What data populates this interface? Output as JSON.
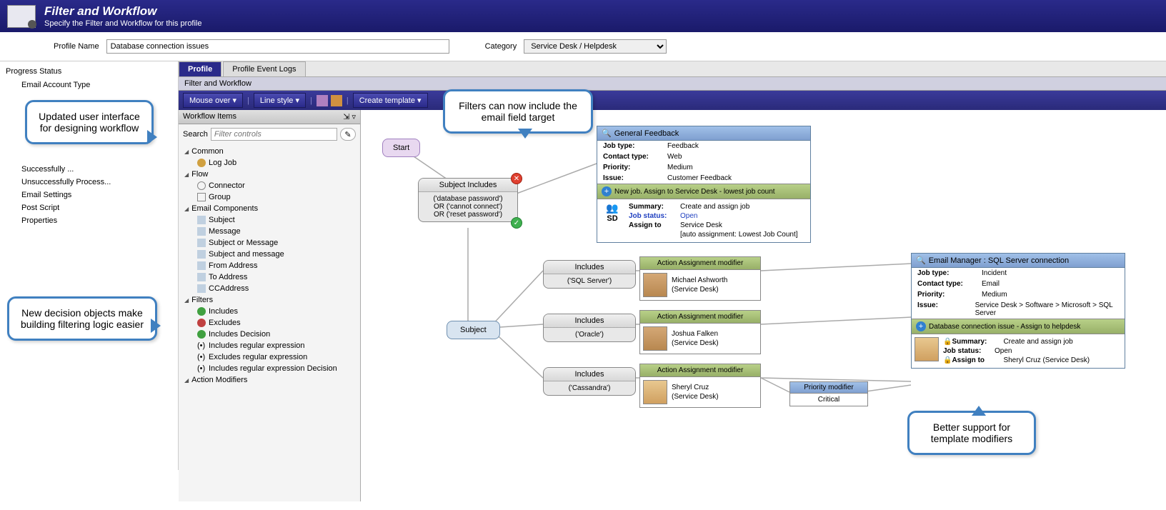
{
  "header": {
    "title": "Filter and Workflow",
    "subtitle": "Specify the Filter and Workflow for this profile"
  },
  "form": {
    "profile_name_label": "Profile Name",
    "profile_name_value": "Database connection issues",
    "category_label": "Category",
    "category_value": "Service Desk / Helpdesk"
  },
  "sidebar": {
    "title": "Progress Status",
    "items": [
      "Email Account Type",
      "",
      "",
      "",
      "",
      "Successfully ...",
      "Unsuccessfully Process...",
      "Email Settings",
      "Post Script",
      "Properties"
    ]
  },
  "tabs": {
    "profile": "Profile",
    "logs": "Profile Event Logs"
  },
  "panel_label": "Filter and Workflow",
  "toolbar": {
    "mouseover": "Mouse over ▾",
    "linestyle": "Line style ▾",
    "create": "Create template ▾"
  },
  "palette": {
    "title": "Workflow Items",
    "search_label": "Search",
    "search_placeholder": "Filter controls",
    "cats": {
      "common": "Common",
      "flow": "Flow",
      "email": "Email Components",
      "filters": "Filters",
      "action": "Action Modifiers"
    },
    "items": {
      "log_job": "Log Job",
      "connector": "Connector",
      "group": "Group",
      "subject": "Subject",
      "message": "Message",
      "subj_or_msg": "Subject or Message",
      "subj_and_msg": "Subject and message",
      "from": "From Address",
      "to": "To Address",
      "cc": "CCAddress",
      "includes": "Includes",
      "excludes": "Excludes",
      "inc_dec": "Includes Decision",
      "inc_re": "Includes regular expression",
      "exc_re": "Excludes regular expression",
      "inc_re_dec": "Includes regular expression Decision"
    }
  },
  "canvas": {
    "start": "Start",
    "subj_inc": {
      "head": "Subject Includes",
      "body": "('database password')\nOR ('cannot connect')\nOR ('reset password')"
    },
    "feedback": {
      "head": "General Feedback",
      "rows": [
        [
          "Job type:",
          "Feedback"
        ],
        [
          "Contact type:",
          "Web"
        ],
        [
          "Priority:",
          "Medium"
        ],
        [
          "Issue:",
          "Customer Feedback"
        ]
      ],
      "action": "New job.  Assign to Service Desk - lowest job count",
      "sd": "SD",
      "assign": [
        [
          "Summary:",
          "Create and assign job"
        ],
        [
          "Job status:",
          "Open"
        ],
        [
          "Assign to",
          "Service Desk"
        ],
        [
          "",
          "[auto assignment: Lowest Job Count]"
        ]
      ]
    },
    "subject_node": "Subject",
    "inc1": {
      "head": "Includes",
      "body": "('SQL Server')"
    },
    "inc2": {
      "head": "Includes",
      "body": "('Oracle')"
    },
    "inc3": {
      "head": "Includes",
      "body": "('Cassandra')"
    },
    "act1": {
      "head": "Action Assignment modifier",
      "name": "Michael Ashworth",
      "dept": "(Service Desk)"
    },
    "act2": {
      "head": "Action Assignment modifier",
      "name": "Joshua Falken",
      "dept": "(Service Desk)"
    },
    "act3": {
      "head": "Action Assignment modifier",
      "name": "Sheryl Cruz",
      "dept": "(Service Desk)"
    },
    "priority": {
      "head": "Priority modifier",
      "body": "Critical"
    },
    "sql_card": {
      "head": "Email Manager : SQL Server connection",
      "rows": [
        [
          "Job type:",
          "Incident"
        ],
        [
          "Contact type:",
          "Email"
        ],
        [
          "Priority:",
          "Medium"
        ],
        [
          "Issue:",
          "Service Desk > Software > Microsoft > SQL Server"
        ]
      ],
      "action": "Database connection issue - Assign to helpdesk",
      "assign": [
        [
          "Summary:",
          "Create and assign job"
        ],
        [
          "Job status:",
          "Open"
        ],
        [
          "Assign to",
          "Sheryl Cruz (Service Desk)"
        ]
      ]
    }
  },
  "callouts": {
    "c1": "Updated user interface for designing workflow",
    "c2": "Filters can now include the email field target",
    "c3": "New decision objects make building filtering logic easier",
    "c4": "Better support for template modifiers"
  }
}
